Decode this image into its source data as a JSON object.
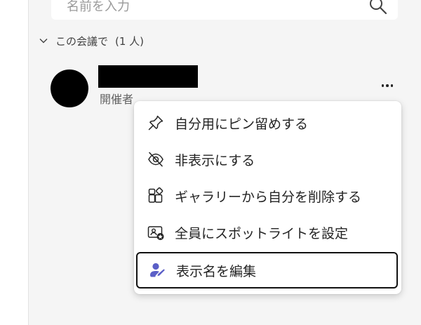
{
  "search": {
    "placeholder": "名前を入力"
  },
  "section": {
    "label": "この会議で",
    "count": "(1 人)"
  },
  "participant": {
    "role": "開催者"
  },
  "menu": {
    "items": [
      {
        "label": "自分用にピン留めする"
      },
      {
        "label": "非表示にする"
      },
      {
        "label": "ギャラリーから自分を削除する"
      },
      {
        "label": "全員にスポットライトを設定"
      },
      {
        "label": "表示名を編集"
      }
    ]
  },
  "colors": {
    "accent": "#5b5fc7",
    "panel_bg": "#f5f5f5"
  },
  "icons": {
    "pin": "pin-icon",
    "hide": "eye-off-icon",
    "remove": "gallery-remove-icon",
    "spotlight": "spotlight-icon",
    "edit": "person-edit-icon"
  }
}
